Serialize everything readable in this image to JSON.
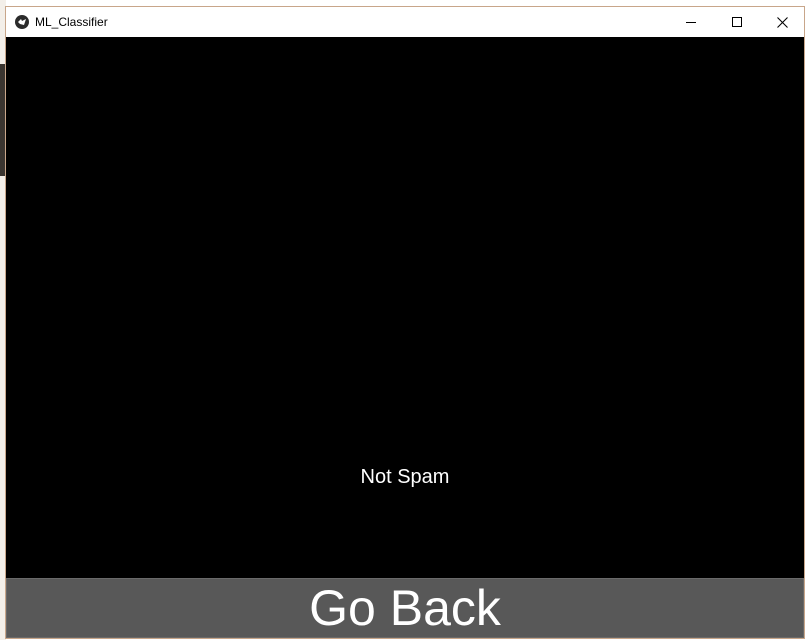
{
  "window": {
    "title": "ML_Classifier"
  },
  "icons": {
    "app": "app-logo-icon",
    "minimize": "minimize-icon",
    "maximize": "maximize-icon",
    "close": "close-icon"
  },
  "main": {
    "result_text": "Not Spam",
    "go_back_label": "Go Back"
  },
  "colors": {
    "content_background": "#000000",
    "button_background": "#585858",
    "text": "#ffffff"
  }
}
